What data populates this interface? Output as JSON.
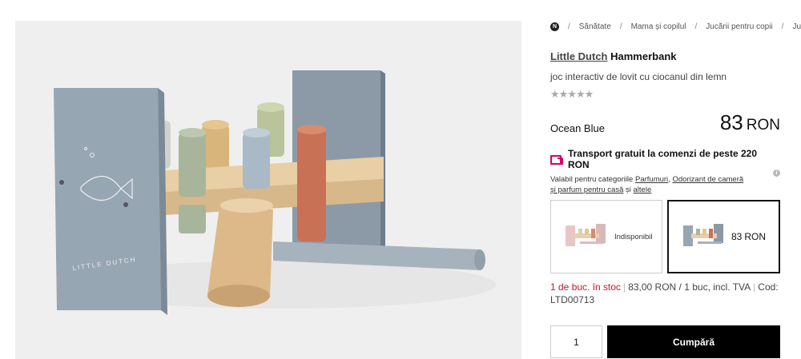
{
  "breadcrumb": {
    "home_icon": "N",
    "items": [
      "Sănătate",
      "Mama și copilul",
      "Jucării pentru copii",
      "Ju"
    ]
  },
  "product": {
    "brand": "Little Dutch",
    "name": "Hammerbank",
    "description": "joc interactiv de lovit cu ciocanul din lemn",
    "rating_stars": "★★★★★",
    "rating_value": 0,
    "variant_name": "Ocean Blue",
    "price": {
      "amount": "83",
      "currency": "RON"
    },
    "image_box_text": "LITTLE DUTCH",
    "colors": {
      "brand_accent": "#d4006a",
      "stock_red": "#c0182a",
      "buy_button": "#000000"
    }
  },
  "shipping": {
    "title": "Transport gratuit la comenzi de peste 220 RON",
    "prefix": "Valabil pentru categoriile",
    "link1": "Parfumuri",
    "comma": ",",
    "link2": "Odorizant de cameră și parfum pentru casă",
    "and": "și",
    "link3": "altele",
    "info_icon": "i"
  },
  "variants": [
    {
      "label": "Indisponibil",
      "theme": "pink"
    },
    {
      "amount": "83",
      "currency": "RON",
      "theme": "blue"
    }
  ],
  "stock": {
    "status": "1 de buc. în stoc",
    "unit_price": "83,00 RON / 1 buc, incl. TVA",
    "code_label": "Cod:",
    "code": "LTD00713"
  },
  "cart": {
    "quantity": "1",
    "buy_label": "Cumpără"
  }
}
